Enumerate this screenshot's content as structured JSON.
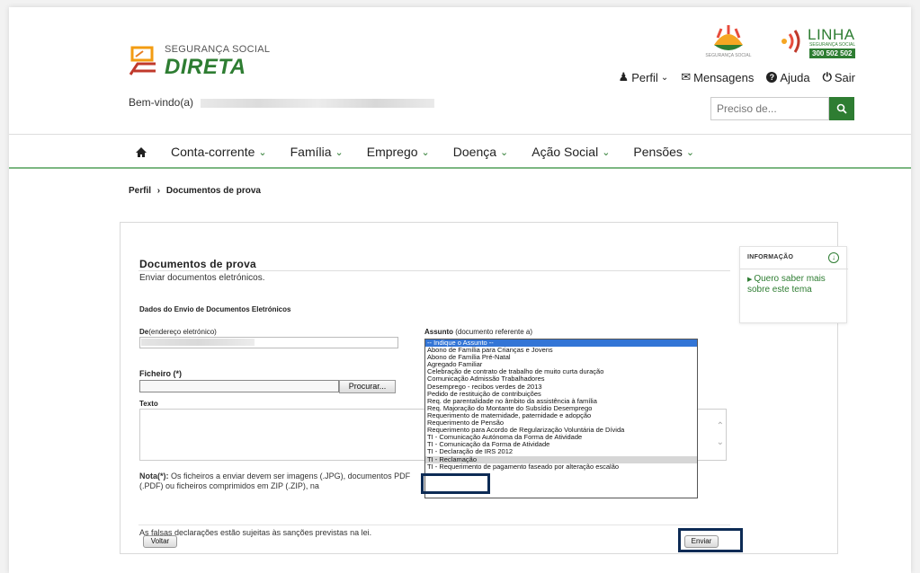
{
  "header": {
    "logo_top": "SEGURANÇA SOCIAL",
    "logo_main": "DIRETA",
    "ss_logo_text": "SEGURANÇA SOCIAL",
    "linha_word": "LINHA",
    "linha_small": "SEGURANÇA SOCIAL",
    "linha_number": "300 502 502",
    "links": {
      "perfil": "Perfil",
      "mensagens": "Mensagens",
      "ajuda": "Ajuda",
      "sair": "Sair"
    },
    "welcome": "Bem-vindo(a)",
    "search_placeholder": "Preciso de..."
  },
  "nav": {
    "items": [
      "Conta-corrente",
      "Família",
      "Emprego",
      "Doença",
      "Ação Social",
      "Pensões"
    ]
  },
  "breadcrumb": {
    "root": "Perfil",
    "sep": "›",
    "current": "Documentos de prova"
  },
  "form": {
    "title": "Documentos de prova",
    "subtitle": "Enviar documentos eletrónicos.",
    "section": "Dados do Envio de Documentos Eletrónicos",
    "de_label_bold": "De",
    "de_label_rest": "(endereço eletrónico)",
    "assunto_label_bold": "Assunto",
    "assunto_label_rest": " (documento referente a)",
    "ficheiro_label": "Ficheiro (*)",
    "procurar": "Procurar...",
    "texto_label": "Texto",
    "nota_bold": "Nota(*):",
    "nota_rest": " Os ficheiros a enviar devem ser imagens (.JPG), documentos PDF (.PDF) ou ficheiros comprimidos em ZIP (.ZIP), na",
    "falsas": "As falsas declarações estão sujeitas às sanções previstas na lei.",
    "voltar": "Voltar",
    "enviar": "Enviar"
  },
  "assunto_options": [
    "-- Indique o Assunto --",
    "Abono de Família para Crianças e Jovens",
    "Abono de Família Pré-Natal",
    "Agregado Familiar",
    "Celebração de contrato de trabalho de muito curta duração",
    "Comunicação Admissão Trabalhadores",
    "Desemprego - recibos verdes de 2013",
    "Pedido de restituição de contribuições",
    "Req. de parentalidade no âmbito da assistência à família",
    "Req. Majoração do Montante do Subsídio Desemprego",
    "Requerimento de maternidade, paternidade e adopção",
    "Requerimento de Pensão",
    "Requerimento para Acordo de Regularização Voluntária de Dívida",
    "TI - Comunicação Autónoma da Forma de Atividade",
    "TI - Comunicação da Forma de Atividade",
    "TI - Declaração de IRS 2012",
    "TI - Reclamação",
    "TI - Requerimento de pagamento faseado por alteração escalão"
  ],
  "info": {
    "heading": "INFORMAÇÃO",
    "link": "Quero saber mais sobre este tema"
  },
  "colors": {
    "brand_green": "#2e7d32",
    "highlight": "#0d2b55",
    "select_blue": "#3375d6"
  }
}
